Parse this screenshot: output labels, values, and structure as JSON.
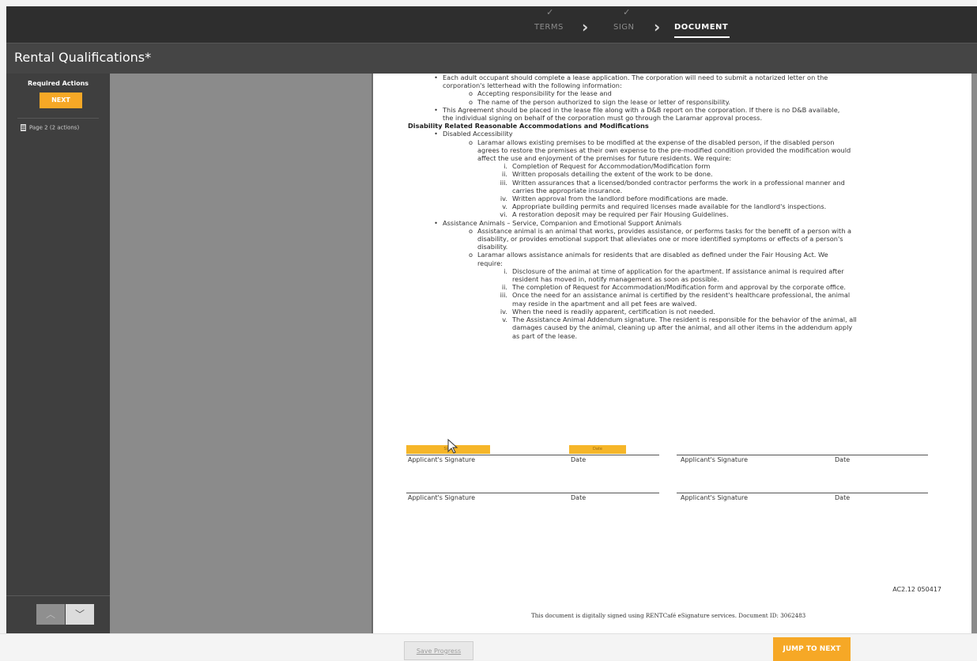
{
  "steps": [
    {
      "label": "TERMS",
      "completed": true
    },
    {
      "label": "SIGN",
      "completed": true
    },
    {
      "label": "DOCUMENT",
      "active": true
    }
  ],
  "title": "Rental Qualifications*",
  "sidebar": {
    "required_actions": "Required Actions",
    "next_label": "NEXT",
    "page_item": "Page 2  (2 actions)",
    "up_glyph": "︿",
    "down_glyph": "﹀"
  },
  "document": {
    "lines": [
      {
        "mk": "•",
        "ind": 1,
        "t": "Each adult occupant should complete a lease application. The corporation will need to submit a notarized letter on the"
      },
      {
        "mk": "",
        "ind": 1,
        "t": "corporation's letterhead with the following information:"
      },
      {
        "mk": "o",
        "ind": 2,
        "t": "Accepting responsibility for the lease and"
      },
      {
        "mk": "o",
        "ind": 2,
        "t": "The name of the person authorized to sign the lease or letter of responsibility."
      },
      {
        "mk": "•",
        "ind": 1,
        "t": "This Agreement should be placed in the lease file along with a D&B report on the corporation. If there is no D&B available,"
      },
      {
        "mk": "",
        "ind": 1,
        "t": "the individual signing on behalf of the corporation must go through the Laramar approval process."
      },
      {
        "mk": "",
        "ind": 0,
        "t": "Disability Related Reasonable Accommodations and Modifications",
        "b": true
      },
      {
        "mk": "•",
        "ind": 1,
        "t": "Disabled Accessibility"
      },
      {
        "mk": "o",
        "ind": 2,
        "t": "Laramar allows existing premises to be modified at the expense of the disabled person, if the disabled person"
      },
      {
        "mk": "",
        "ind": 2,
        "t": "agrees to restore the premises at their own expense to the pre-modified condition provided the modification would"
      },
      {
        "mk": "",
        "ind": 2,
        "t": "affect the use and enjoyment of the premises for future residents. We require:"
      },
      {
        "mk": "i.",
        "ind": 3,
        "t": "Completion of Request for Accommodation/Modification form"
      },
      {
        "mk": "ii.",
        "ind": 3,
        "t": "Written proposals detailing the extent of the work to be done."
      },
      {
        "mk": "iii.",
        "ind": 3,
        "t": "Written assurances that a licensed/bonded contractor performs the work in a professional manner and"
      },
      {
        "mk": "",
        "ind": 3,
        "t": "carries the appropriate insurance."
      },
      {
        "mk": "iv.",
        "ind": 3,
        "t": "Written approval from the landlord before modifications are made."
      },
      {
        "mk": "v.",
        "ind": 3,
        "t": "Appropriate building permits and required licenses made available for the landlord's inspections."
      },
      {
        "mk": "vi.",
        "ind": 3,
        "t": "A restoration deposit may be required per Fair Housing Guidelines."
      },
      {
        "mk": "•",
        "ind": 1,
        "t": "Assistance Animals – Service, Companion and Emotional Support Animals"
      },
      {
        "mk": "o",
        "ind": 2,
        "t": "Assistance animal is an animal that works, provides assistance, or performs tasks for the benefit of a person with a"
      },
      {
        "mk": "",
        "ind": 2,
        "t": "disability, or provides emotional support that alleviates one or more identified symptoms or effects of a person's"
      },
      {
        "mk": "",
        "ind": 2,
        "t": "disability."
      },
      {
        "mk": "o",
        "ind": 2,
        "t": "Laramar allows assistance animals for residents that are disabled as defined under the Fair Housing Act. We"
      },
      {
        "mk": "",
        "ind": 2,
        "t": "require:"
      },
      {
        "mk": "i.",
        "ind": 3,
        "t": "Disclosure of the animal at time of application for the apartment.  If assistance animal is required after"
      },
      {
        "mk": "",
        "ind": 3,
        "t": "resident has moved in, notify management as soon as possible."
      },
      {
        "mk": "ii.",
        "ind": 3,
        "t": "The completion of Request for Accommodation/Modification form and approval by the corporate office."
      },
      {
        "mk": "iii.",
        "ind": 3,
        "t": "Once the need for an assistance animal is certified by the resident's healthcare professional, the animal"
      },
      {
        "mk": "",
        "ind": 3,
        "t": "may reside in the apartment and all pet fees are waived."
      },
      {
        "mk": "iv.",
        "ind": 3,
        "t": "When the need is readily apparent, certification is not needed."
      },
      {
        "mk": "v.",
        "ind": 3,
        "t": "The Assistance Animal Addendum signature. The resident is responsible for the behavior of the animal, all"
      },
      {
        "mk": "",
        "ind": 3,
        "t": "damages caused by the animal, cleaning up after the animal, and all other items in the addendum apply"
      },
      {
        "mk": "",
        "ind": 3,
        "t": "as part of the lease."
      }
    ],
    "sign_tag": "Sign",
    "date_tag": "Date",
    "applicant_signature": "Applicant's Signature",
    "date": "Date",
    "doc_code": "AC2.12 050417",
    "footnote": "This document is digitally signed using RENTCafé eSignature services. Document ID: 3062483"
  },
  "footer": {
    "save_progress": "Save Progress",
    "jump_to_next": "JUMP TO NEXT"
  },
  "colors": {
    "accent": "#f6a826",
    "topbar": "#2e2e2e",
    "titlebar": "#454545",
    "sidebar": "#3f3f3f"
  }
}
